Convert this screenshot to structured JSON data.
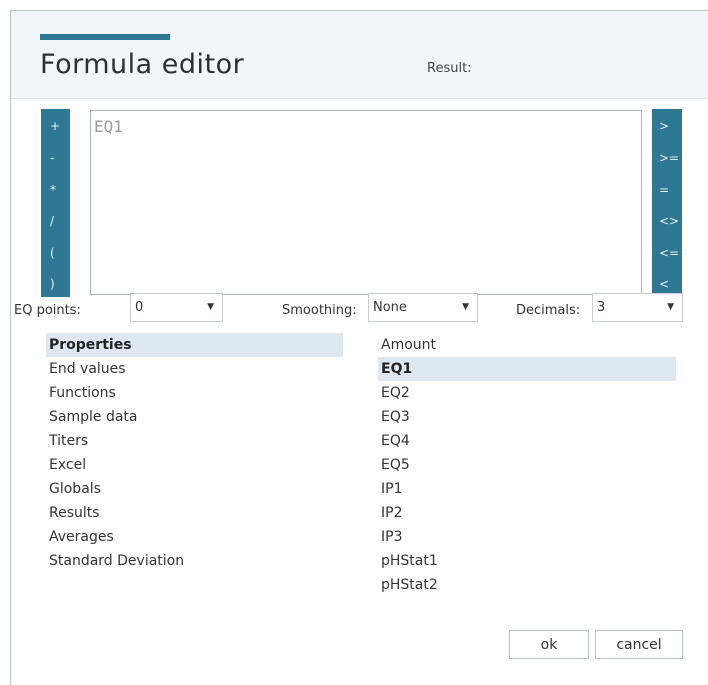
{
  "dialog": {
    "title": "Formula editor",
    "result_label": "Result:"
  },
  "operators_left": [
    "+",
    "-",
    "*",
    "/",
    "(",
    ")"
  ],
  "operators_right": [
    ">",
    ">=",
    "=",
    "<>",
    "<=",
    "<"
  ],
  "formula": {
    "value": "EQ1"
  },
  "options": {
    "eq_points": {
      "label": "EQ points:",
      "value": "0"
    },
    "smoothing": {
      "label": "Smoothing:",
      "value": "None"
    },
    "decimals": {
      "label": "Decimals:",
      "value": "3"
    }
  },
  "categories": [
    {
      "label": "Properties",
      "selected": true
    },
    {
      "label": "End values",
      "selected": false
    },
    {
      "label": "Functions",
      "selected": false
    },
    {
      "label": "Sample data",
      "selected": false
    },
    {
      "label": "Titers",
      "selected": false
    },
    {
      "label": "Excel",
      "selected": false
    },
    {
      "label": "Globals",
      "selected": false
    },
    {
      "label": "Results",
      "selected": false
    },
    {
      "label": "Averages",
      "selected": false
    },
    {
      "label": "Standard Deviation",
      "selected": false
    }
  ],
  "fields": [
    {
      "label": "Amount",
      "selected": false
    },
    {
      "label": "EQ1",
      "selected": true
    },
    {
      "label": "EQ2",
      "selected": false
    },
    {
      "label": "EQ3",
      "selected": false
    },
    {
      "label": "EQ4",
      "selected": false
    },
    {
      "label": "EQ5",
      "selected": false
    },
    {
      "label": "IP1",
      "selected": false
    },
    {
      "label": "IP2",
      "selected": false
    },
    {
      "label": "IP3",
      "selected": false
    },
    {
      "label": "pHStat1",
      "selected": false
    },
    {
      "label": "pHStat2",
      "selected": false
    }
  ],
  "buttons": {
    "ok": "ok",
    "cancel": "cancel"
  },
  "colors": {
    "accent": "#2e7893",
    "selection": "#dde8f2",
    "header_bg": "#f3f6f8"
  }
}
